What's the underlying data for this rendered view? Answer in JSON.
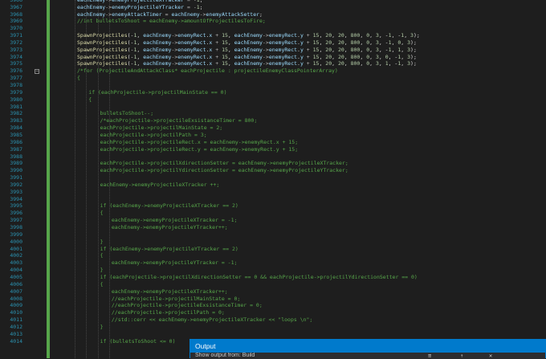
{
  "line_numbers": [
    "3966",
    "3967",
    "3968",
    "3969",
    "3970",
    "3971",
    "3972",
    "3973",
    "3974",
    "3975",
    "3976",
    "3977",
    "3978",
    "3979",
    "3980",
    "3981",
    "3982",
    "3983",
    "3984",
    "3985",
    "3986",
    "3987",
    "3988",
    "3989",
    "3990",
    "3991",
    "3992",
    "3993",
    "3994",
    "3995",
    "3996",
    "3997",
    "3998",
    "3999",
    "4000",
    "4001",
    "4002",
    "4003",
    "4004",
    "4005",
    "4006",
    "4007",
    "4008",
    "4009",
    "4010",
    "4011",
    "4012",
    "4013",
    "4014"
  ],
  "code_lines": [
    {
      "indent": 2,
      "tokens": [
        [
          "var",
          "eachEnemy"
        ],
        [
          "op",
          "->"
        ],
        [
          "var",
          "enemyProjectileXTracker"
        ],
        [
          "op",
          " = -"
        ],
        [
          "num",
          "1"
        ],
        [
          "pl",
          ";"
        ]
      ]
    },
    {
      "indent": 2,
      "tokens": [
        [
          "var",
          "eachEnemy"
        ],
        [
          "op",
          "->"
        ],
        [
          "var",
          "enemyProjectileYTracker"
        ],
        [
          "op",
          " = -"
        ],
        [
          "num",
          "1"
        ],
        [
          "pl",
          ";"
        ]
      ]
    },
    {
      "indent": 2,
      "tokens": [
        [
          "var",
          "eachEnemy"
        ],
        [
          "op",
          "->"
        ],
        [
          "var",
          "enemyAttackTimer"
        ],
        [
          "op",
          " = "
        ],
        [
          "var",
          "eachEnemy"
        ],
        [
          "op",
          "->"
        ],
        [
          "var",
          "enemyAttackSetter"
        ],
        [
          "pl",
          ";"
        ]
      ]
    },
    {
      "indent": 2,
      "tokens": [
        [
          "com",
          "//int bulletsToShoot = eachEnemy->amountOfProjectilesToFire;"
        ]
      ]
    },
    {
      "indent": 0,
      "tokens": []
    },
    {
      "indent": 2,
      "tokens": [
        [
          "fn",
          "SpawnProjectiles"
        ],
        [
          "pl",
          "(-"
        ],
        [
          "num",
          "1"
        ],
        [
          "pl",
          ", "
        ],
        [
          "var",
          "eachEnemy"
        ],
        [
          "op",
          "->"
        ],
        [
          "var",
          "enemyRect"
        ],
        [
          "pl",
          "."
        ],
        [
          "var",
          "x"
        ],
        [
          "op",
          " + "
        ],
        [
          "num",
          "15"
        ],
        [
          "pl",
          ", "
        ],
        [
          "var",
          "eachEnemy"
        ],
        [
          "op",
          "->"
        ],
        [
          "var",
          "enemyRect"
        ],
        [
          "pl",
          "."
        ],
        [
          "var",
          "y"
        ],
        [
          "op",
          " + "
        ],
        [
          "num",
          "15"
        ],
        [
          "pl",
          ", "
        ],
        [
          "num",
          "20"
        ],
        [
          "pl",
          ", "
        ],
        [
          "num",
          "20"
        ],
        [
          "pl",
          ", "
        ],
        [
          "num",
          "800"
        ],
        [
          "pl",
          ", "
        ],
        [
          "num",
          "0"
        ],
        [
          "pl",
          ", "
        ],
        [
          "num",
          "3"
        ],
        [
          "pl",
          ", -"
        ],
        [
          "num",
          "1"
        ],
        [
          "pl",
          ", -"
        ],
        [
          "num",
          "1"
        ],
        [
          "pl",
          ", "
        ],
        [
          "num",
          "3"
        ],
        [
          "pl",
          ");"
        ]
      ]
    },
    {
      "indent": 2,
      "tokens": [
        [
          "fn",
          "SpawnProjectiles"
        ],
        [
          "pl",
          "(-"
        ],
        [
          "num",
          "1"
        ],
        [
          "pl",
          ", "
        ],
        [
          "var",
          "eachEnemy"
        ],
        [
          "op",
          "->"
        ],
        [
          "var",
          "enemyRect"
        ],
        [
          "pl",
          "."
        ],
        [
          "var",
          "x"
        ],
        [
          "op",
          " + "
        ],
        [
          "num",
          "15"
        ],
        [
          "pl",
          ", "
        ],
        [
          "var",
          "eachEnemy"
        ],
        [
          "op",
          "->"
        ],
        [
          "var",
          "enemyRect"
        ],
        [
          "pl",
          "."
        ],
        [
          "var",
          "y"
        ],
        [
          "op",
          " + "
        ],
        [
          "num",
          "15"
        ],
        [
          "pl",
          ", "
        ],
        [
          "num",
          "20"
        ],
        [
          "pl",
          ", "
        ],
        [
          "num",
          "20"
        ],
        [
          "pl",
          ", "
        ],
        [
          "num",
          "800"
        ],
        [
          "pl",
          ", "
        ],
        [
          "num",
          "0"
        ],
        [
          "pl",
          ", "
        ],
        [
          "num",
          "3"
        ],
        [
          "pl",
          ", -"
        ],
        [
          "num",
          "1"
        ],
        [
          "pl",
          ", "
        ],
        [
          "num",
          "0"
        ],
        [
          "pl",
          ", "
        ],
        [
          "num",
          "3"
        ],
        [
          "pl",
          ");"
        ]
      ]
    },
    {
      "indent": 2,
      "tokens": [
        [
          "fn",
          "SpawnProjectiles"
        ],
        [
          "pl",
          "(-"
        ],
        [
          "num",
          "1"
        ],
        [
          "pl",
          ", "
        ],
        [
          "var",
          "eachEnemy"
        ],
        [
          "op",
          "->"
        ],
        [
          "var",
          "enemyRect"
        ],
        [
          "pl",
          "."
        ],
        [
          "var",
          "x"
        ],
        [
          "op",
          " + "
        ],
        [
          "num",
          "15"
        ],
        [
          "pl",
          ", "
        ],
        [
          "var",
          "eachEnemy"
        ],
        [
          "op",
          "->"
        ],
        [
          "var",
          "enemyRect"
        ],
        [
          "pl",
          "."
        ],
        [
          "var",
          "y"
        ],
        [
          "op",
          " + "
        ],
        [
          "num",
          "15"
        ],
        [
          "pl",
          ", "
        ],
        [
          "num",
          "20"
        ],
        [
          "pl",
          ", "
        ],
        [
          "num",
          "20"
        ],
        [
          "pl",
          ", "
        ],
        [
          "num",
          "800"
        ],
        [
          "pl",
          ", "
        ],
        [
          "num",
          "0"
        ],
        [
          "pl",
          ", "
        ],
        [
          "num",
          "3"
        ],
        [
          "pl",
          ", -"
        ],
        [
          "num",
          "1"
        ],
        [
          "pl",
          ", "
        ],
        [
          "num",
          "1"
        ],
        [
          "pl",
          ", "
        ],
        [
          "num",
          "3"
        ],
        [
          "pl",
          ");"
        ]
      ]
    },
    {
      "indent": 2,
      "tokens": [
        [
          "fn",
          "SpawnProjectiles"
        ],
        [
          "pl",
          "(-"
        ],
        [
          "num",
          "1"
        ],
        [
          "pl",
          ", "
        ],
        [
          "var",
          "eachEnemy"
        ],
        [
          "op",
          "->"
        ],
        [
          "var",
          "enemyRect"
        ],
        [
          "pl",
          "."
        ],
        [
          "var",
          "x"
        ],
        [
          "op",
          " + "
        ],
        [
          "num",
          "15"
        ],
        [
          "pl",
          ", "
        ],
        [
          "var",
          "eachEnemy"
        ],
        [
          "op",
          "->"
        ],
        [
          "var",
          "enemyRect"
        ],
        [
          "pl",
          "."
        ],
        [
          "var",
          "y"
        ],
        [
          "op",
          " + "
        ],
        [
          "num",
          "15"
        ],
        [
          "pl",
          ", "
        ],
        [
          "num",
          "20"
        ],
        [
          "pl",
          ", "
        ],
        [
          "num",
          "20"
        ],
        [
          "pl",
          ", "
        ],
        [
          "num",
          "800"
        ],
        [
          "pl",
          ", "
        ],
        [
          "num",
          "0"
        ],
        [
          "pl",
          ", "
        ],
        [
          "num",
          "3"
        ],
        [
          "pl",
          ", "
        ],
        [
          "num",
          "0"
        ],
        [
          "pl",
          ", -"
        ],
        [
          "num",
          "1"
        ],
        [
          "pl",
          ", "
        ],
        [
          "num",
          "3"
        ],
        [
          "pl",
          ");"
        ]
      ]
    },
    {
      "indent": 2,
      "tokens": [
        [
          "fn",
          "SpawnProjectiles"
        ],
        [
          "pl",
          "(-"
        ],
        [
          "num",
          "1"
        ],
        [
          "pl",
          ", "
        ],
        [
          "var",
          "eachEnemy"
        ],
        [
          "op",
          "->"
        ],
        [
          "var",
          "enemyRect"
        ],
        [
          "pl",
          "."
        ],
        [
          "var",
          "x"
        ],
        [
          "op",
          " + "
        ],
        [
          "num",
          "15"
        ],
        [
          "pl",
          ", "
        ],
        [
          "var",
          "eachEnemy"
        ],
        [
          "op",
          "->"
        ],
        [
          "var",
          "enemyRect"
        ],
        [
          "pl",
          "."
        ],
        [
          "var",
          "y"
        ],
        [
          "op",
          " + "
        ],
        [
          "num",
          "15"
        ],
        [
          "pl",
          ", "
        ],
        [
          "num",
          "20"
        ],
        [
          "pl",
          ", "
        ],
        [
          "num",
          "20"
        ],
        [
          "pl",
          ", "
        ],
        [
          "num",
          "800"
        ],
        [
          "pl",
          ", "
        ],
        [
          "num",
          "0"
        ],
        [
          "pl",
          ", "
        ],
        [
          "num",
          "3"
        ],
        [
          "pl",
          ", "
        ],
        [
          "num",
          "1"
        ],
        [
          "pl",
          ", -"
        ],
        [
          "num",
          "1"
        ],
        [
          "pl",
          ", "
        ],
        [
          "num",
          "3"
        ],
        [
          "pl",
          ");"
        ]
      ]
    },
    {
      "indent": 2,
      "tokens": [
        [
          "com",
          "/*for (ProjectileAndAttackClass* eachProjectile : projectileEnemyClassPointerArray)"
        ]
      ]
    },
    {
      "indent": 2,
      "tokens": [
        [
          "com",
          "{"
        ]
      ]
    },
    {
      "indent": 0,
      "tokens": []
    },
    {
      "indent": 3,
      "tokens": [
        [
          "com",
          "if (eachProjectile->projectilMainState == 0)"
        ]
      ]
    },
    {
      "indent": 3,
      "tokens": [
        [
          "com",
          "{"
        ]
      ]
    },
    {
      "indent": 0,
      "tokens": []
    },
    {
      "indent": 4,
      "tokens": [
        [
          "com",
          "bulletsToShoot--;"
        ]
      ]
    },
    {
      "indent": 4,
      "tokens": [
        [
          "com",
          "/*eachProjectile->projectileExsistanceTimer = 800;"
        ]
      ]
    },
    {
      "indent": 4,
      "tokens": [
        [
          "com",
          "eachProjectile->projectilMainState = 2;"
        ]
      ]
    },
    {
      "indent": 4,
      "tokens": [
        [
          "com",
          "eachProjectile->projectilPath = 3;"
        ]
      ]
    },
    {
      "indent": 4,
      "tokens": [
        [
          "com",
          "eachProjectile->projectileRect.x = eachEnemy->enemyRect.x + 15;"
        ]
      ]
    },
    {
      "indent": 4,
      "tokens": [
        [
          "com",
          "eachProjectile->projectileRect.y = eachEnemy->enemyRect.y + 15;"
        ]
      ]
    },
    {
      "indent": 0,
      "tokens": []
    },
    {
      "indent": 4,
      "tokens": [
        [
          "com",
          "eachProjectile->projectilXdirectionSetter = eachEnemy->enemyProjectileXTracker;"
        ]
      ]
    },
    {
      "indent": 4,
      "tokens": [
        [
          "com",
          "eachProjectile->projectilYdirectionSetter = eachEnemy->enemyProjectileYTracker;"
        ]
      ]
    },
    {
      "indent": 0,
      "tokens": []
    },
    {
      "indent": 4,
      "tokens": [
        [
          "com",
          "eachEnemy->enemyProjectileXTracker ++;"
        ]
      ]
    },
    {
      "indent": 0,
      "tokens": []
    },
    {
      "indent": 0,
      "tokens": []
    },
    {
      "indent": 4,
      "tokens": [
        [
          "com",
          "if (eachEnemy->enemyProjectileXTracker == 2)"
        ]
      ]
    },
    {
      "indent": 4,
      "tokens": [
        [
          "com",
          "{"
        ]
      ]
    },
    {
      "indent": 5,
      "tokens": [
        [
          "com",
          "eachEnemy->enemyProjectileXTracker = -1;"
        ]
      ]
    },
    {
      "indent": 5,
      "tokens": [
        [
          "com",
          "eachEnemy->enemyProjectileYTracker++;"
        ]
      ]
    },
    {
      "indent": 0,
      "tokens": []
    },
    {
      "indent": 4,
      "tokens": [
        [
          "com",
          "}"
        ]
      ]
    },
    {
      "indent": 4,
      "tokens": [
        [
          "com",
          "if (eachEnemy->enemyProjectileYTracker == 2)"
        ]
      ]
    },
    {
      "indent": 4,
      "tokens": [
        [
          "com",
          "{"
        ]
      ]
    },
    {
      "indent": 5,
      "tokens": [
        [
          "com",
          "eachEnemy->enemyProjectileYTracker = -1;"
        ]
      ]
    },
    {
      "indent": 4,
      "tokens": [
        [
          "com",
          "}"
        ]
      ]
    },
    {
      "indent": 4,
      "tokens": [
        [
          "com",
          "if (eachProjectile->projectilXdirectionSetter == 0 && eachProjectile->projectilYdirectionSetter == 0)"
        ]
      ]
    },
    {
      "indent": 4,
      "tokens": [
        [
          "com",
          "{"
        ]
      ]
    },
    {
      "indent": 5,
      "tokens": [
        [
          "com",
          "eachEnemy->enemyProjectileXTracker++;"
        ]
      ]
    },
    {
      "indent": 5,
      "tokens": [
        [
          "com",
          "//eachProjectile->projectilMainState = 0;"
        ]
      ]
    },
    {
      "indent": 5,
      "tokens": [
        [
          "com",
          "//eachProjectile->projectileExsistanceTimer = 0;"
        ]
      ]
    },
    {
      "indent": 5,
      "tokens": [
        [
          "com",
          "//eachProjectile->projectilPath = 0;"
        ]
      ]
    },
    {
      "indent": 5,
      "tokens": [
        [
          "com",
          "//std::cerr << eachEnemy->enemyProjectileXTracker << \"loops \\n\";"
        ]
      ]
    },
    {
      "indent": 4,
      "tokens": [
        [
          "com",
          "}"
        ]
      ]
    },
    {
      "indent": 0,
      "tokens": []
    },
    {
      "indent": 4,
      "tokens": [
        [
          "com",
          "if (bulletsToShoot <= 0)"
        ]
      ]
    }
  ],
  "fold_marker": "−",
  "output_panel": {
    "title": "Output",
    "toolbar_label": "Show output from:  Build",
    "toolbar_icons": [
      "≡",
      "⇡",
      "✕"
    ]
  },
  "colors": {
    "editor_bg": "#1e1e1e",
    "line_number": "#2b91af",
    "comment": "#57a64a",
    "keyword": "#569cd6",
    "accent": "#007acc"
  }
}
